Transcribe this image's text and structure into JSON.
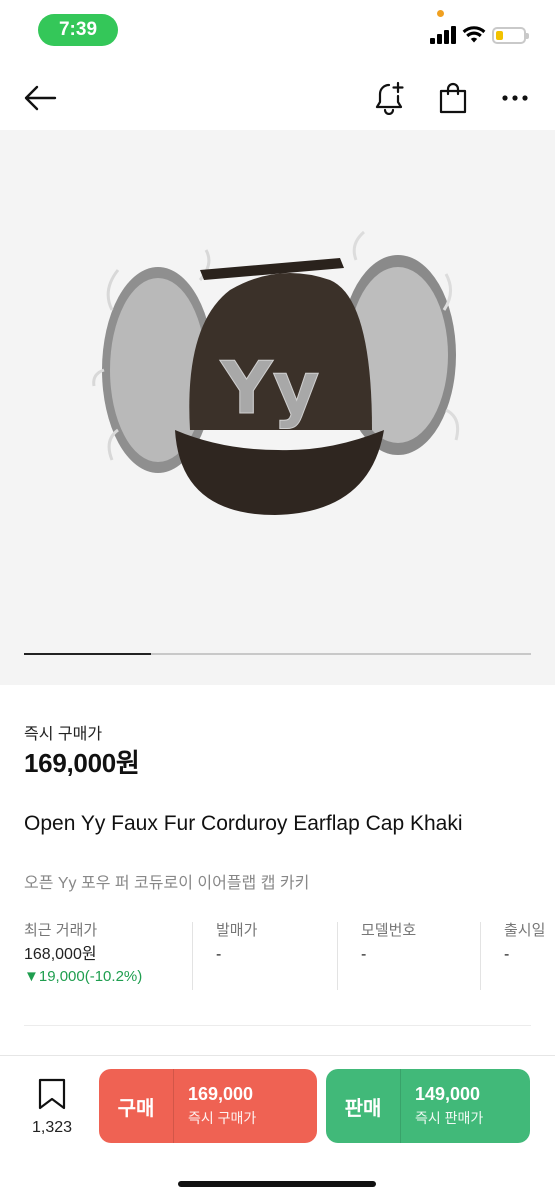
{
  "status": {
    "time": "7:39"
  },
  "colors": {
    "accent_buy": "#ef6253",
    "accent_sell": "#41b979",
    "price_down": "#1f9e4f",
    "time_pill": "#34c759"
  },
  "icons": {
    "back": "arrow-left-icon",
    "alert": "bell-plus-icon",
    "cart": "shopping-bag-icon",
    "more": "more-horizontal-icon",
    "wish": "bookmark-icon"
  },
  "product": {
    "image_text": "Yy",
    "image_index": 1,
    "image_count": 4,
    "price_label": "즉시 구매가",
    "price": "169,000원",
    "title_en": "Open Yy Faux Fur Corduroy Earflap Cap Khaki",
    "title_ko": "오픈 Yy 포우 퍼 코듀로이 이어플랩 캡 카키"
  },
  "info": {
    "recent_label": "최근 거래가",
    "recent_value": "168,000원",
    "recent_change": "▼19,000(-10.2%)",
    "release_price_label": "발매가",
    "release_price_value": "-",
    "model_label": "모델번호",
    "model_value": "-",
    "release_date_label": "출시일",
    "release_date_value": "-"
  },
  "bottom": {
    "wish_count": "1,323",
    "buy": {
      "label": "구매",
      "price": "169,000",
      "sub": "즉시 구매가"
    },
    "sell": {
      "label": "판매",
      "price": "149,000",
      "sub": "즉시 판매가"
    }
  }
}
